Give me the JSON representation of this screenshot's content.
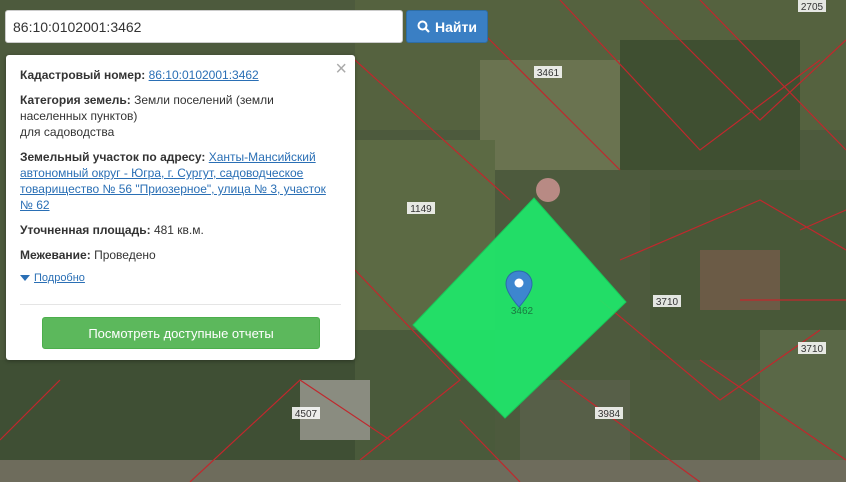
{
  "search": {
    "value": "86:10:0102001:3462",
    "button_label": "Найти",
    "button_icon": "search-icon"
  },
  "popup": {
    "close_symbol": "×",
    "cadastral_label": "Кадастровый номер:",
    "cadastral_value": "86:10:0102001:3462",
    "category_label": "Категория земель:",
    "category_value_1": "Земли поселений (земли",
    "category_value_2": "населенных пунктов)",
    "category_value_3": "для садоводства",
    "address_label": "Земельный участок по адресу:",
    "address_value_1": "Ханты-Мансийский",
    "address_value_2": "автономный округ - Югра, г. Сургут, садоводческое",
    "address_value_3": "товарищество № 56 \"Приозерное\", улица № 3, участок",
    "address_value_4": "№ 62",
    "area_label": "Уточненная площадь:",
    "area_value": "481 кв.м.",
    "survey_label": "Межевание:",
    "survey_value": "Проведено",
    "more_label": "Подробно",
    "reports_button": "Посмотреть доступные отчеты"
  },
  "map": {
    "parcel_labels": [
      "2705",
      "3461",
      "1149",
      "3710",
      "3710",
      "4507",
      "3984"
    ],
    "selected_label": "3462",
    "selected_color": "#1ee86a",
    "boundary_color": "#c0282d"
  }
}
